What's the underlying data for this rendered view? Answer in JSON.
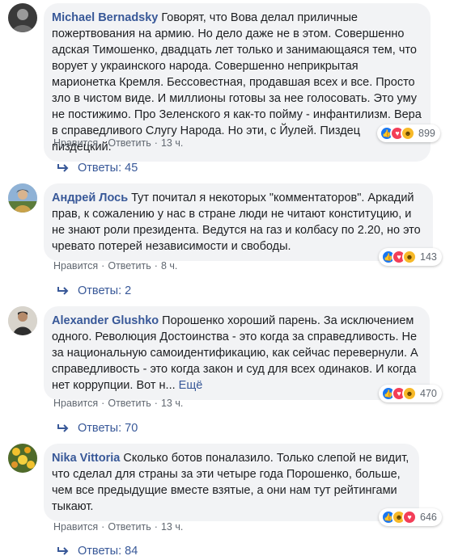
{
  "comments": [
    {
      "author": "Michael Bernadsky",
      "text": "Говорят, что Вова делал приличные пожертвования на армию. Но дело даже не в этом. Совершенно адская Тимошенко, двадцать лет только и занимающаяся тем, что ворует у украинского народа. Совершенно неприкрытая марионетка Кремля. Бессовестная, продавшая всех и все. Просто зло в чистом виде. И миллионы готовы за нее голосовать. Это уму не постижимо. Про Зеленского я как-то пойму - инфантилизм. Вера в справедливого Слугу Народа. Но эти, с Йулей. Пиздец пиздецкий.",
      "more": "",
      "like_label": "Нравится",
      "reply_label": "Ответить",
      "time": "13 ч.",
      "reactions": [
        "like-icon",
        "love-icon",
        "haha-icon"
      ],
      "reaction_count": "899",
      "replies_label": "Ответы: 45"
    },
    {
      "author": "Андрей Лось",
      "text": "Тут почитал я некоторых \"комментаторов\". Аркадий прав, к сожалению у нас в стране люди не читают конституцию, и не знают роли президента. Ведутся на газ и колбасу по 2.20, но это чревато потерей независимости и свободы.",
      "more": "",
      "like_label": "Нравится",
      "reply_label": "Ответить",
      "time": "8 ч.",
      "reactions": [
        "like-icon",
        "love-icon",
        "haha-icon"
      ],
      "reaction_count": "143",
      "replies_label": "Ответы: 2"
    },
    {
      "author": "Alexander Glushko",
      "text": "Порошенко хороший парень. За исключением одного. Революция Достоинства - это когда за справедливость. Не за национальную самоидентификацию, как сейчас перевернули. А справедливость - это когда закон и суд для всех одинаков. И когда нет коррупции. Вот н...",
      "more": "Ещё",
      "like_label": "Нравится",
      "reply_label": "Ответить",
      "time": "13 ч.",
      "reactions": [
        "like-icon",
        "love-icon",
        "haha-icon"
      ],
      "reaction_count": "470",
      "replies_label": "Ответы: 70"
    },
    {
      "author": "Nika Vittoria",
      "text": "Сколько ботов поналазило. Только слепой не видит, что сделал для страны за эти четыре года Порошенко, больше, чем все предыдущие вместе взятые, а они нам тут рейтингами тыкают.",
      "more": "",
      "like_label": "Нравится",
      "reply_label": "Ответить",
      "time": "13 ч.",
      "reactions": [
        "like-icon",
        "haha-icon",
        "love-icon"
      ],
      "reaction_count": "646",
      "replies_label": "Ответы: 84"
    }
  ],
  "colors": {
    "author": "#385898",
    "bubble": "#f2f3f5",
    "meta": "#606770",
    "like": "#1877f2",
    "love": "#f33e58",
    "haha": "#f7b928"
  }
}
